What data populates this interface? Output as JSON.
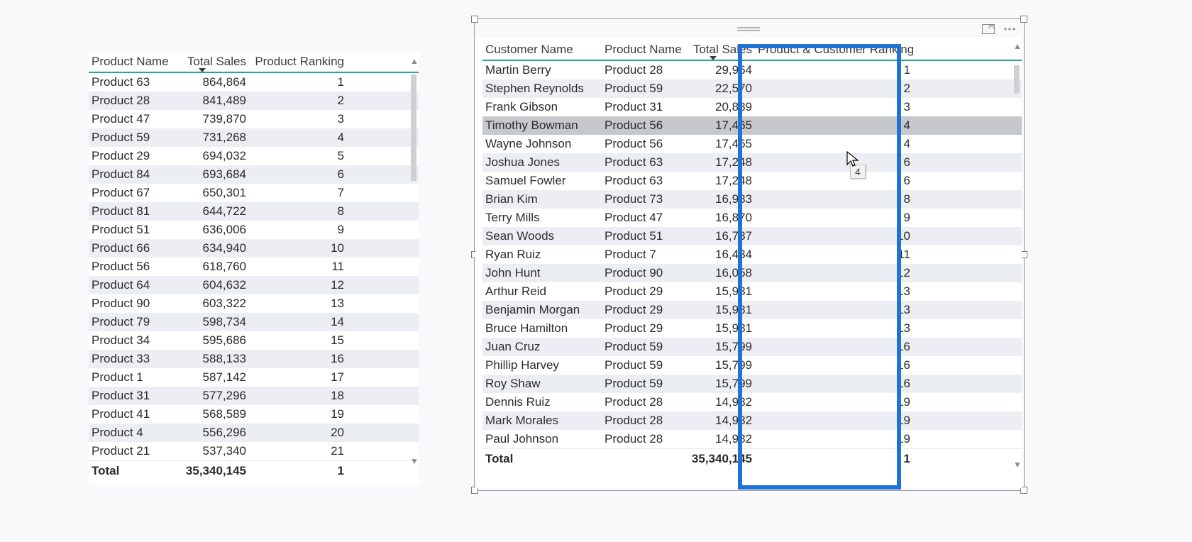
{
  "tooltip_value": "4",
  "left": {
    "headers": {
      "product": "Product Name",
      "sales": "Total Sales",
      "rank": "Product Ranking"
    },
    "footer": {
      "label": "Total",
      "sales": "35,340,145",
      "rank": "1"
    },
    "rows": [
      {
        "product": "Product 63",
        "sales": "864,864",
        "rank": "1"
      },
      {
        "product": "Product 28",
        "sales": "841,489",
        "rank": "2"
      },
      {
        "product": "Product 47",
        "sales": "739,870",
        "rank": "3"
      },
      {
        "product": "Product 59",
        "sales": "731,268",
        "rank": "4"
      },
      {
        "product": "Product 29",
        "sales": "694,032",
        "rank": "5"
      },
      {
        "product": "Product 84",
        "sales": "693,684",
        "rank": "6"
      },
      {
        "product": "Product 67",
        "sales": "650,301",
        "rank": "7"
      },
      {
        "product": "Product 81",
        "sales": "644,722",
        "rank": "8"
      },
      {
        "product": "Product 51",
        "sales": "636,006",
        "rank": "9"
      },
      {
        "product": "Product 66",
        "sales": "634,940",
        "rank": "10"
      },
      {
        "product": "Product 56",
        "sales": "618,760",
        "rank": "11"
      },
      {
        "product": "Product 64",
        "sales": "604,632",
        "rank": "12"
      },
      {
        "product": "Product 90",
        "sales": "603,322",
        "rank": "13"
      },
      {
        "product": "Product 79",
        "sales": "598,734",
        "rank": "14"
      },
      {
        "product": "Product 34",
        "sales": "595,686",
        "rank": "15"
      },
      {
        "product": "Product 33",
        "sales": "588,133",
        "rank": "16"
      },
      {
        "product": "Product 1",
        "sales": "587,142",
        "rank": "17"
      },
      {
        "product": "Product 31",
        "sales": "577,296",
        "rank": "18"
      },
      {
        "product": "Product 41",
        "sales": "568,589",
        "rank": "19"
      },
      {
        "product": "Product 4",
        "sales": "556,296",
        "rank": "20"
      },
      {
        "product": "Product 21",
        "sales": "537,340",
        "rank": "21"
      }
    ]
  },
  "right": {
    "headers": {
      "customer": "Customer Name",
      "product": "Product Name",
      "sales": "Total Sales",
      "rank": "Product & Customer Ranking"
    },
    "footer": {
      "label": "Total",
      "sales": "35,340,145",
      "rank": "1"
    },
    "highlight_row_index": 3,
    "rows": [
      {
        "customer": "Martin Berry",
        "product": "Product 28",
        "sales": "29,964",
        "rank": "1"
      },
      {
        "customer": "Stephen Reynolds",
        "product": "Product 59",
        "sales": "22,570",
        "rank": "2"
      },
      {
        "customer": "Frank Gibson",
        "product": "Product 31",
        "sales": "20,889",
        "rank": "3"
      },
      {
        "customer": "Timothy Bowman",
        "product": "Product 56",
        "sales": "17,465",
        "rank": "4"
      },
      {
        "customer": "Wayne Johnson",
        "product": "Product 56",
        "sales": "17,465",
        "rank": "4"
      },
      {
        "customer": "Joshua Jones",
        "product": "Product 63",
        "sales": "17,248",
        "rank": "6"
      },
      {
        "customer": "Samuel Fowler",
        "product": "Product 63",
        "sales": "17,248",
        "rank": "6"
      },
      {
        "customer": "Brian Kim",
        "product": "Product 73",
        "sales": "16,983",
        "rank": "8"
      },
      {
        "customer": "Terry Mills",
        "product": "Product 47",
        "sales": "16,870",
        "rank": "9"
      },
      {
        "customer": "Sean Woods",
        "product": "Product 51",
        "sales": "16,737",
        "rank": "10"
      },
      {
        "customer": "Ryan Ruiz",
        "product": "Product 7",
        "sales": "16,434",
        "rank": "11"
      },
      {
        "customer": "John Hunt",
        "product": "Product 90",
        "sales": "16,058",
        "rank": "12"
      },
      {
        "customer": "Arthur Reid",
        "product": "Product 29",
        "sales": "15,981",
        "rank": "13"
      },
      {
        "customer": "Benjamin Morgan",
        "product": "Product 29",
        "sales": "15,981",
        "rank": "13"
      },
      {
        "customer": "Bruce Hamilton",
        "product": "Product 29",
        "sales": "15,981",
        "rank": "13"
      },
      {
        "customer": "Juan Cruz",
        "product": "Product 59",
        "sales": "15,799",
        "rank": "16"
      },
      {
        "customer": "Phillip Harvey",
        "product": "Product 59",
        "sales": "15,799",
        "rank": "16"
      },
      {
        "customer": "Roy Shaw",
        "product": "Product 59",
        "sales": "15,799",
        "rank": "16"
      },
      {
        "customer": "Dennis Ruiz",
        "product": "Product 28",
        "sales": "14,982",
        "rank": "19"
      },
      {
        "customer": "Mark Morales",
        "product": "Product 28",
        "sales": "14,982",
        "rank": "19"
      },
      {
        "customer": "Paul Johnson",
        "product": "Product 28",
        "sales": "14,982",
        "rank": "19"
      }
    ]
  }
}
